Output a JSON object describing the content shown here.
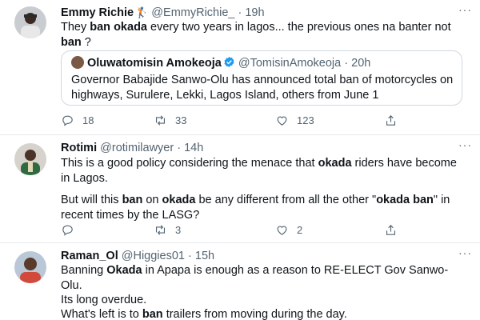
{
  "tweets": [
    {
      "name": "Emmy Richie",
      "name_emoji": "🏌",
      "handle": "@EmmyRichie_",
      "separator": "·",
      "time": "19h",
      "text": [
        {
          "t": "They "
        },
        {
          "t": "ban",
          "b": true
        },
        {
          "t": " "
        },
        {
          "t": "okada",
          "b": true
        },
        {
          "t": " every two years in lagos... the previous ones na banter not "
        },
        {
          "t": "ban",
          "b": true
        },
        {
          "t": " ?"
        }
      ],
      "quote": {
        "name": "Oluwatomisin Amokeoja",
        "handle": "@TomisinAmokeoja",
        "separator": "·",
        "time": "20h",
        "text": "Governor Babajide Sanwo-Olu has announced total ban of motorcycles on highways, Surulere, Lekki, Lagos Island, others from June 1"
      },
      "actions": {
        "replies": "18",
        "retweets": "33",
        "likes": "123"
      }
    },
    {
      "name": "Rotimi",
      "handle": "@rotimilawyer",
      "separator": "·",
      "time": "14h",
      "text1": [
        {
          "t": "This is a good policy considering the menace that "
        },
        {
          "t": "okada",
          "b": true
        },
        {
          "t": " riders have become in Lagos."
        }
      ],
      "text2": [
        {
          "t": "But will this "
        },
        {
          "t": "ban",
          "b": true
        },
        {
          "t": " on "
        },
        {
          "t": "okada",
          "b": true
        },
        {
          "t": " be any different from all the other \""
        },
        {
          "t": "okada ban",
          "b": true
        },
        {
          "t": "\" in recent times by the LASG?"
        }
      ],
      "actions": {
        "replies": "",
        "retweets": "3",
        "likes": "2"
      }
    },
    {
      "name": "Raman_Ol",
      "handle": "@Higgies01",
      "separator": "·",
      "time": "15h",
      "text": [
        {
          "t": "Banning "
        },
        {
          "t": "Okada",
          "b": true
        },
        {
          "t": " in Apapa is enough as a reason to RE-ELECT Gov Sanwo-Olu."
        }
      ],
      "text2": "Its long overdue.",
      "text3": [
        {
          "t": "What's left is to "
        },
        {
          "t": "ban",
          "b": true
        },
        {
          "t": " trailers from moving during the day."
        }
      ]
    }
  ],
  "more_label": "···",
  "colors": {
    "verified": "#1d9bf0",
    "muted": "#536471",
    "divider": "#e6e9ec"
  }
}
